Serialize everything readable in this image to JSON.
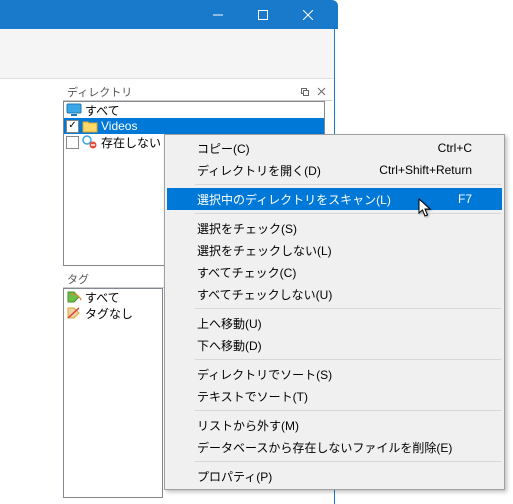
{
  "titlebar": {
    "min": "minimize",
    "max": "maximize",
    "close": "close"
  },
  "panel_dir": {
    "title": "ディレクトリ",
    "items": [
      {
        "label": "すべて",
        "checked": false,
        "icon": "all"
      },
      {
        "label": "Videos",
        "checked": true,
        "icon": "folder",
        "selected": true
      },
      {
        "label": "存在しない",
        "checked": false,
        "icon": "missing"
      }
    ]
  },
  "panel_tag": {
    "title": "タグ",
    "items": [
      {
        "label": "すべて",
        "icon": "tag-all"
      },
      {
        "label": "タグなし",
        "icon": "tag-none"
      }
    ]
  },
  "context_menu": {
    "groups": [
      [
        {
          "label": "コピー(C)",
          "accel": "Ctrl+C"
        },
        {
          "label": "ディレクトリを開く(D)",
          "accel": "Ctrl+Shift+Return"
        }
      ],
      [
        {
          "label": "選択中のディレクトリをスキャン(L)",
          "accel": "F7",
          "highlight": true
        }
      ],
      [
        {
          "label": "選択をチェック(S)"
        },
        {
          "label": "選択をチェックしない(L)"
        },
        {
          "label": "すべてチェック(C)"
        },
        {
          "label": "すべてチェックしない(U)"
        }
      ],
      [
        {
          "label": "上へ移動(U)"
        },
        {
          "label": "下へ移動(D)"
        }
      ],
      [
        {
          "label": "ディレクトリでソート(S)"
        },
        {
          "label": "テキストでソート(T)"
        }
      ],
      [
        {
          "label": "リストから外す(M)"
        },
        {
          "label": "データベースから存在しないファイルを削除(E)"
        }
      ],
      [
        {
          "label": "プロパティ(P)"
        }
      ]
    ]
  }
}
